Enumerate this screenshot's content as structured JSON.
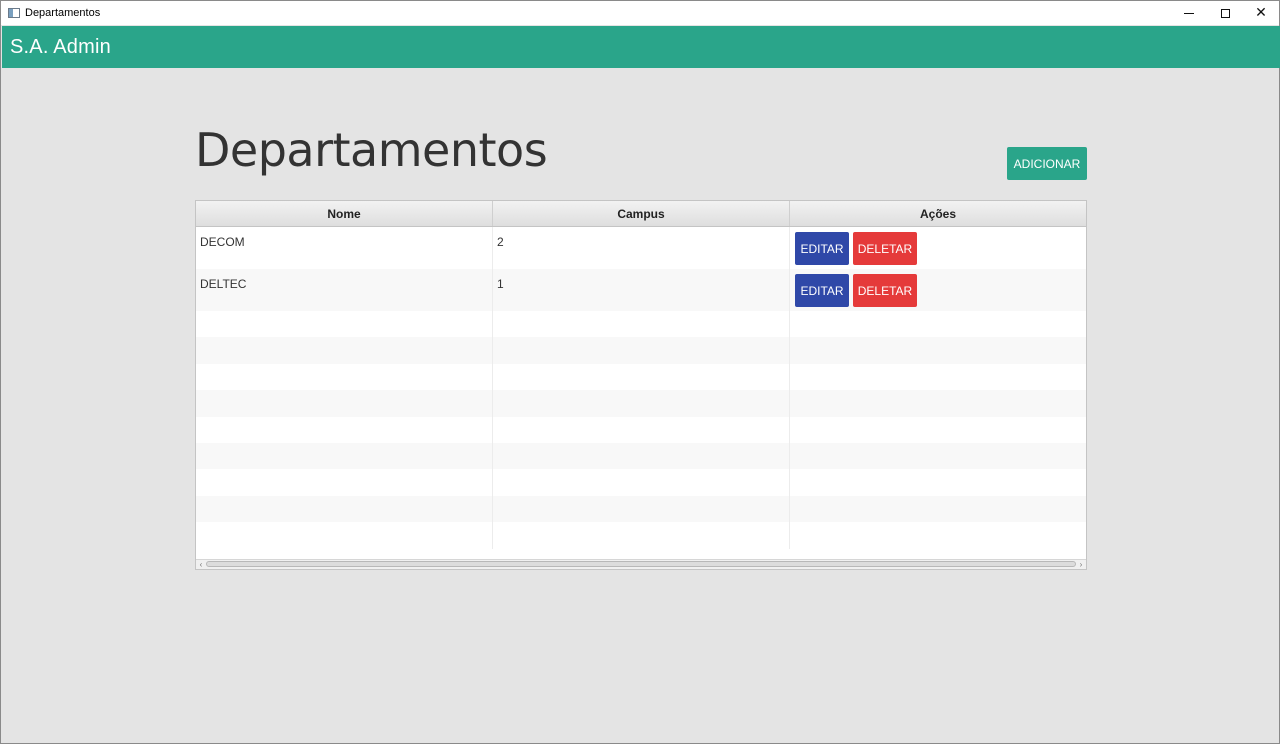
{
  "window": {
    "title": "Departamentos",
    "controls": {
      "minimize": "minimize-icon",
      "maximize": "maximize-icon",
      "close": "close-icon"
    }
  },
  "appbar": {
    "brand": "S.A. Admin"
  },
  "main": {
    "title": "Departamentos",
    "add_label": "ADICIONAR"
  },
  "table": {
    "headers": [
      "Nome",
      "Campus",
      "Ações"
    ],
    "rows": [
      {
        "nome": "DECOM",
        "campus": "2",
        "edit_label": "EDITAR",
        "delete_label": "DELETAR"
      },
      {
        "nome": "DELTEC",
        "campus": "1",
        "edit_label": "EDITAR",
        "delete_label": "DELETAR"
      }
    ]
  },
  "colors": {
    "primary": "#2aa58a",
    "edit": "#2f48a8",
    "delete": "#e53a3a"
  }
}
